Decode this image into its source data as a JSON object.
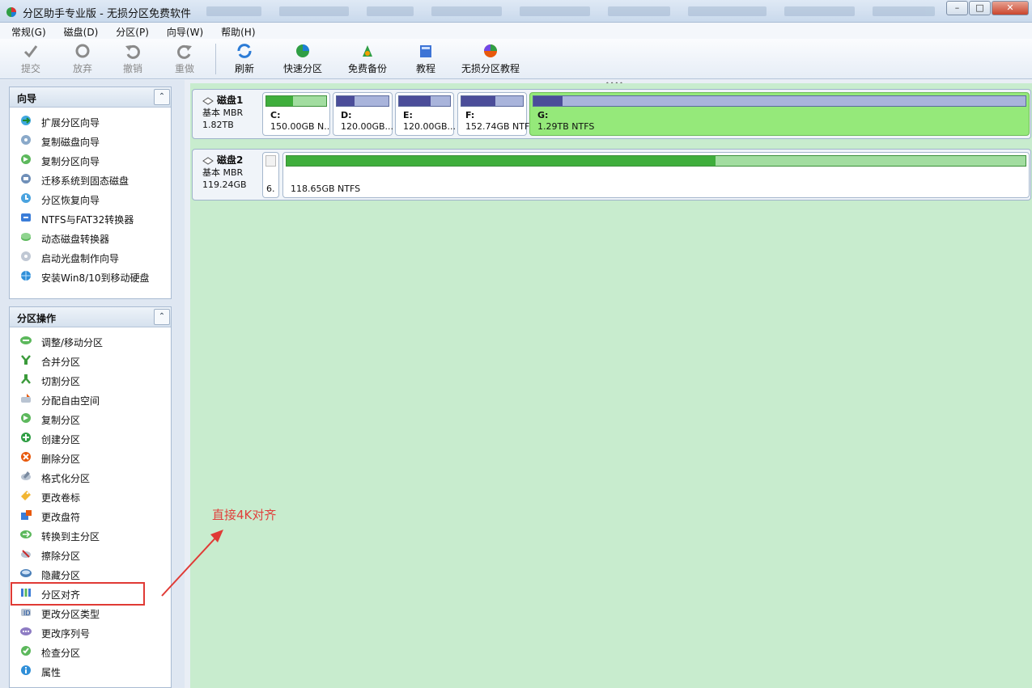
{
  "window": {
    "title": "分区助手专业版 - 无损分区免费软件",
    "controls": [
      "minimize",
      "maximize",
      "close"
    ]
  },
  "menu": [
    {
      "label": "常规(G)"
    },
    {
      "label": "磁盘(D)"
    },
    {
      "label": "分区(P)"
    },
    {
      "label": "向导(W)"
    },
    {
      "label": "帮助(H)"
    }
  ],
  "toolbar": {
    "commit": "提交",
    "discard": "放弃",
    "undo": "撤销",
    "redo": "重做",
    "refresh": "刷新",
    "quick_partition": "快速分区",
    "free_backup": "免费备份",
    "tutorial": "教程",
    "lossless_tutorial": "无损分区教程"
  },
  "wizard_panel": {
    "title": "向导",
    "items": [
      {
        "label": "扩展分区向导"
      },
      {
        "label": "复制磁盘向导"
      },
      {
        "label": "复制分区向导"
      },
      {
        "label": "迁移系统到固态磁盘"
      },
      {
        "label": "分区恢复向导"
      },
      {
        "label": "NTFS与FAT32转换器"
      },
      {
        "label": "动态磁盘转换器"
      },
      {
        "label": "启动光盘制作向导"
      },
      {
        "label": "安装Win8/10到移动硬盘"
      }
    ]
  },
  "ops_panel": {
    "title": "分区操作",
    "items": [
      {
        "label": "调整/移动分区"
      },
      {
        "label": "合并分区"
      },
      {
        "label": "切割分区"
      },
      {
        "label": "分配自由空间"
      },
      {
        "label": "复制分区"
      },
      {
        "label": "创建分区"
      },
      {
        "label": "删除分区"
      },
      {
        "label": "格式化分区"
      },
      {
        "label": "更改卷标"
      },
      {
        "label": "更改盘符"
      },
      {
        "label": "转换到主分区"
      },
      {
        "label": "擦除分区"
      },
      {
        "label": "隐藏分区"
      },
      {
        "label": "分区对齐"
      },
      {
        "label": "更改分区类型"
      },
      {
        "label": "更改序列号"
      },
      {
        "label": "检查分区"
      },
      {
        "label": "属性"
      }
    ]
  },
  "disks": [
    {
      "name": "磁盘1",
      "type": "基本 MBR",
      "size": "1.82TB",
      "partitions": [
        {
          "letter": "C:",
          "size": "150.00GB N...",
          "used": 0.45,
          "style": "green"
        },
        {
          "letter": "D:",
          "size": "120.00GB...",
          "used": 0.35,
          "style": "blue"
        },
        {
          "letter": "E:",
          "size": "120.00GB...",
          "used": 0.62,
          "style": "blue"
        },
        {
          "letter": "F:",
          "size": "152.74GB NTFS",
          "used": 0.55,
          "style": "blue"
        },
        {
          "letter": "G:",
          "size": "1.29TB NTFS",
          "used": 0.06,
          "style": "blue",
          "selected": true
        }
      ]
    },
    {
      "name": "磁盘2",
      "type": "基本 MBR",
      "size": "119.24GB",
      "partitions": [
        {
          "letter": "6.",
          "size": "",
          "used": 0.0,
          "style": "empty"
        },
        {
          "letter": "",
          "size": "118.65GB NTFS",
          "used": 0.58,
          "style": "green"
        }
      ]
    }
  ],
  "annotation": {
    "text": "直接4K对齐",
    "color": "#e0403c"
  },
  "colors": {
    "main_bg": "#c8ecce",
    "selected_partition": "#95e97a",
    "used_blue": "#4b4d99",
    "used_green": "#3fae3c",
    "highlight": "#e03a35"
  }
}
